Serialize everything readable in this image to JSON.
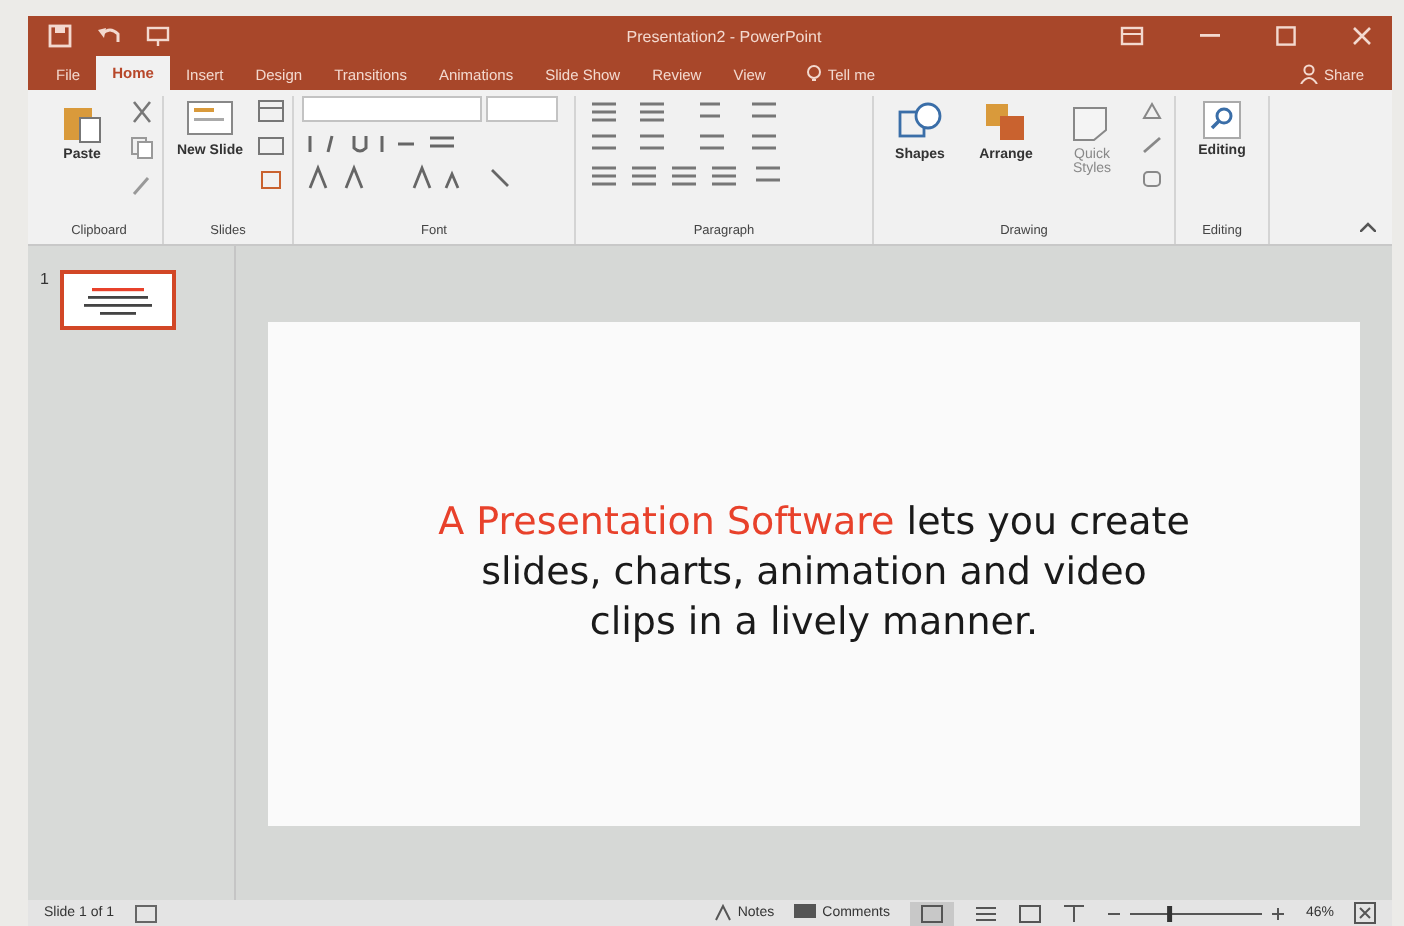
{
  "window": {
    "title": "Presentation2 - PowerPoint"
  },
  "tabs": [
    {
      "label": "File",
      "selected": false
    },
    {
      "label": "Home",
      "selected": true
    },
    {
      "label": "Insert",
      "selected": false
    },
    {
      "label": "Design",
      "selected": false
    },
    {
      "label": "Transitions",
      "selected": false
    },
    {
      "label": "Animations",
      "selected": false
    },
    {
      "label": "Slide Show",
      "selected": false
    },
    {
      "label": "Review",
      "selected": false
    },
    {
      "label": "View",
      "selected": false
    }
  ],
  "tell_me": "Tell me",
  "share": "Share",
  "ribbon": {
    "groups": [
      {
        "kind": "clipboard",
        "label": "Clipboard",
        "buttons": [
          "Paste"
        ]
      },
      {
        "kind": "slides",
        "label": "Slides",
        "buttons": [
          "New Slide"
        ]
      },
      {
        "kind": "font",
        "label": "Font"
      },
      {
        "kind": "paragraph",
        "label": "Paragraph"
      },
      {
        "kind": "drawing",
        "label": "Drawing",
        "buttons": [
          "Shapes",
          "Arrange",
          "Quick Styles"
        ]
      },
      {
        "kind": "editing",
        "label": "Editing",
        "buttons": [
          "Editing"
        ]
      }
    ]
  },
  "thumbnails": [
    {
      "number": "1",
      "selected": true
    }
  ],
  "slide": {
    "text_parts": [
      {
        "kind": "highlight",
        "text": "A Presentation Software"
      },
      {
        "kind": "plain",
        "text": "lets you create slides, charts, animation and video clips in a lively manner."
      }
    ]
  },
  "status_bar": {
    "slide_info": "Slide 1 of 1",
    "notes": "Notes",
    "comments": "Comments",
    "zoom": "46%",
    "zoom_slider": {
      "level": 0.3
    }
  }
}
